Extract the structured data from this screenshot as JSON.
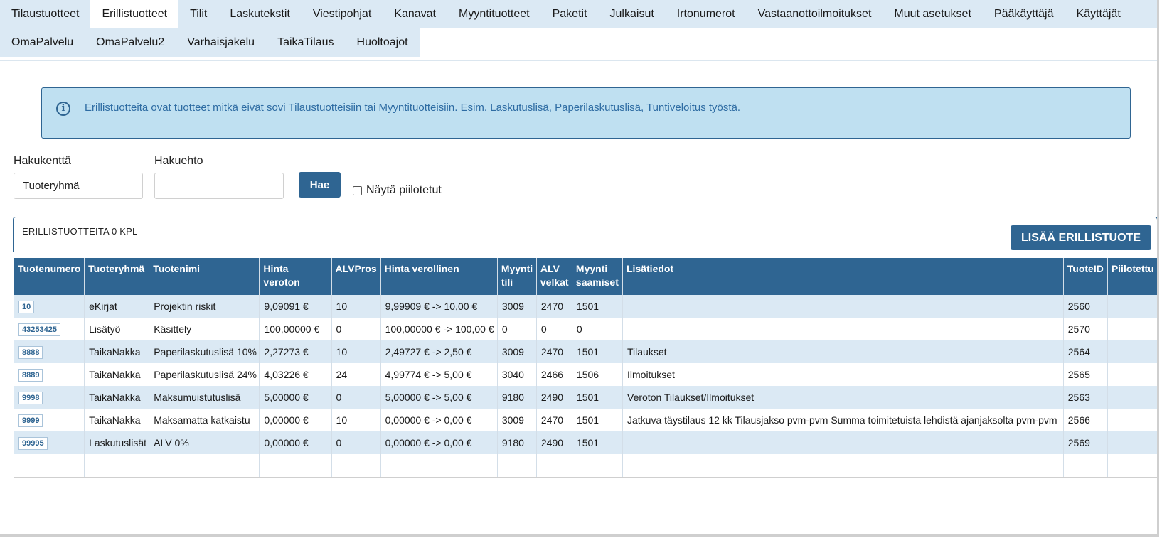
{
  "tabs_row1": [
    "Tilaustuotteet",
    "Erillistuotteet",
    "Tilit",
    "Laskutekstit",
    "Viestipohjat",
    "Kanavat",
    "Myyntituotteet",
    "Paketit",
    "Julkaisut",
    "Irtonumerot",
    "Vastaanottoilmoitukset",
    "Muut asetukset",
    "Pääkäyttäjä",
    "Käyttäjät"
  ],
  "tabs_row2": [
    "OmaPalvelu",
    "OmaPalvelu2",
    "Varhaisjakelu",
    "TaikaTilaus",
    "Huoltoajot"
  ],
  "active_tab": "Erillistuotteet",
  "info": {
    "icon": "info-circle-icon",
    "text": "Erillistuotteita ovat tuotteet mitkä eivät sovi Tilaustuotteisiin tai Myyntituotteisiin. Esim. Laskutuslisä, Paperilaskutuslisä, Tuntiveloitus työstä."
  },
  "search": {
    "field_label": "Hakukenttä",
    "field_value": "Tuoteryhmä",
    "condition_label": "Hakuehto",
    "condition_value": "",
    "button": "Hae",
    "show_hidden_label": "Näytä piilotetut",
    "show_hidden_checked": false
  },
  "panel": {
    "title": "ERILLISTUOTTEITA 0 KPL",
    "add_button": "LISÄÄ ERILLISTUOTE"
  },
  "table": {
    "headers": [
      "Tuotenumero",
      "Tuoteryhmä",
      "Tuotenimi",
      "Hinta veroton",
      "ALVPros",
      "Hinta verollinen",
      "Myynti tili",
      "ALV velkat",
      "Myynti saamiset",
      "Lisätiedot",
      "TuoteID",
      "Piilotettu"
    ],
    "rows": [
      [
        "10",
        "eKirjat",
        "Projektin riskit",
        "9,09091 €",
        "10",
        "9,99909 € -> 10,00 €",
        "3009",
        "2470",
        "1501",
        "",
        "2560",
        ""
      ],
      [
        "43253425",
        "Lisätyö",
        "Käsittely",
        "100,00000 €",
        "0",
        "100,00000 € -> 100,00 €",
        "0",
        "0",
        "0",
        "",
        "2570",
        ""
      ],
      [
        "8888",
        "TaikaNakka",
        "Paperilaskutuslisä 10%",
        "2,27273 €",
        "10",
        "2,49727 € -> 2,50 €",
        "3009",
        "2470",
        "1501",
        "Tilaukset",
        "2564",
        ""
      ],
      [
        "8889",
        "TaikaNakka",
        "Paperilaskutuslisä 24%",
        "4,03226 €",
        "24",
        "4,99774 € -> 5,00 €",
        "3040",
        "2466",
        "1506",
        "Ilmoitukset",
        "2565",
        ""
      ],
      [
        "9998",
        "TaikaNakka",
        "Maksumuistutuslisä",
        "5,00000 €",
        "0",
        "5,00000 € -> 5,00 €",
        "9180",
        "2490",
        "1501",
        "Veroton Tilaukset/Ilmoitukset",
        "2563",
        ""
      ],
      [
        "9999",
        "TaikaNakka",
        "Maksamatta katkaistu",
        "0,00000 €",
        "10",
        "0,00000 € -> 0,00 €",
        "3009",
        "2470",
        "1501",
        "Jatkuva täystilaus 12 kk Tilausjakso pvm-pvm Summa toimitetuista lehdistä ajanjaksolta pvm-pvm",
        "2566",
        ""
      ],
      [
        "99995",
        "Laskutuslisät",
        "ALV 0%",
        "0,00000 €",
        "0",
        "0,00000 € -> 0,00 €",
        "9180",
        "2490",
        "1501",
        "",
        "2569",
        ""
      ]
    ]
  },
  "colors": {
    "primary": "#2f6592",
    "tab_bg": "#dbe9f4",
    "info_bg": "#bfe0f1",
    "info_text": "#2e6ca3",
    "row_alt": "#dbe9f4"
  }
}
